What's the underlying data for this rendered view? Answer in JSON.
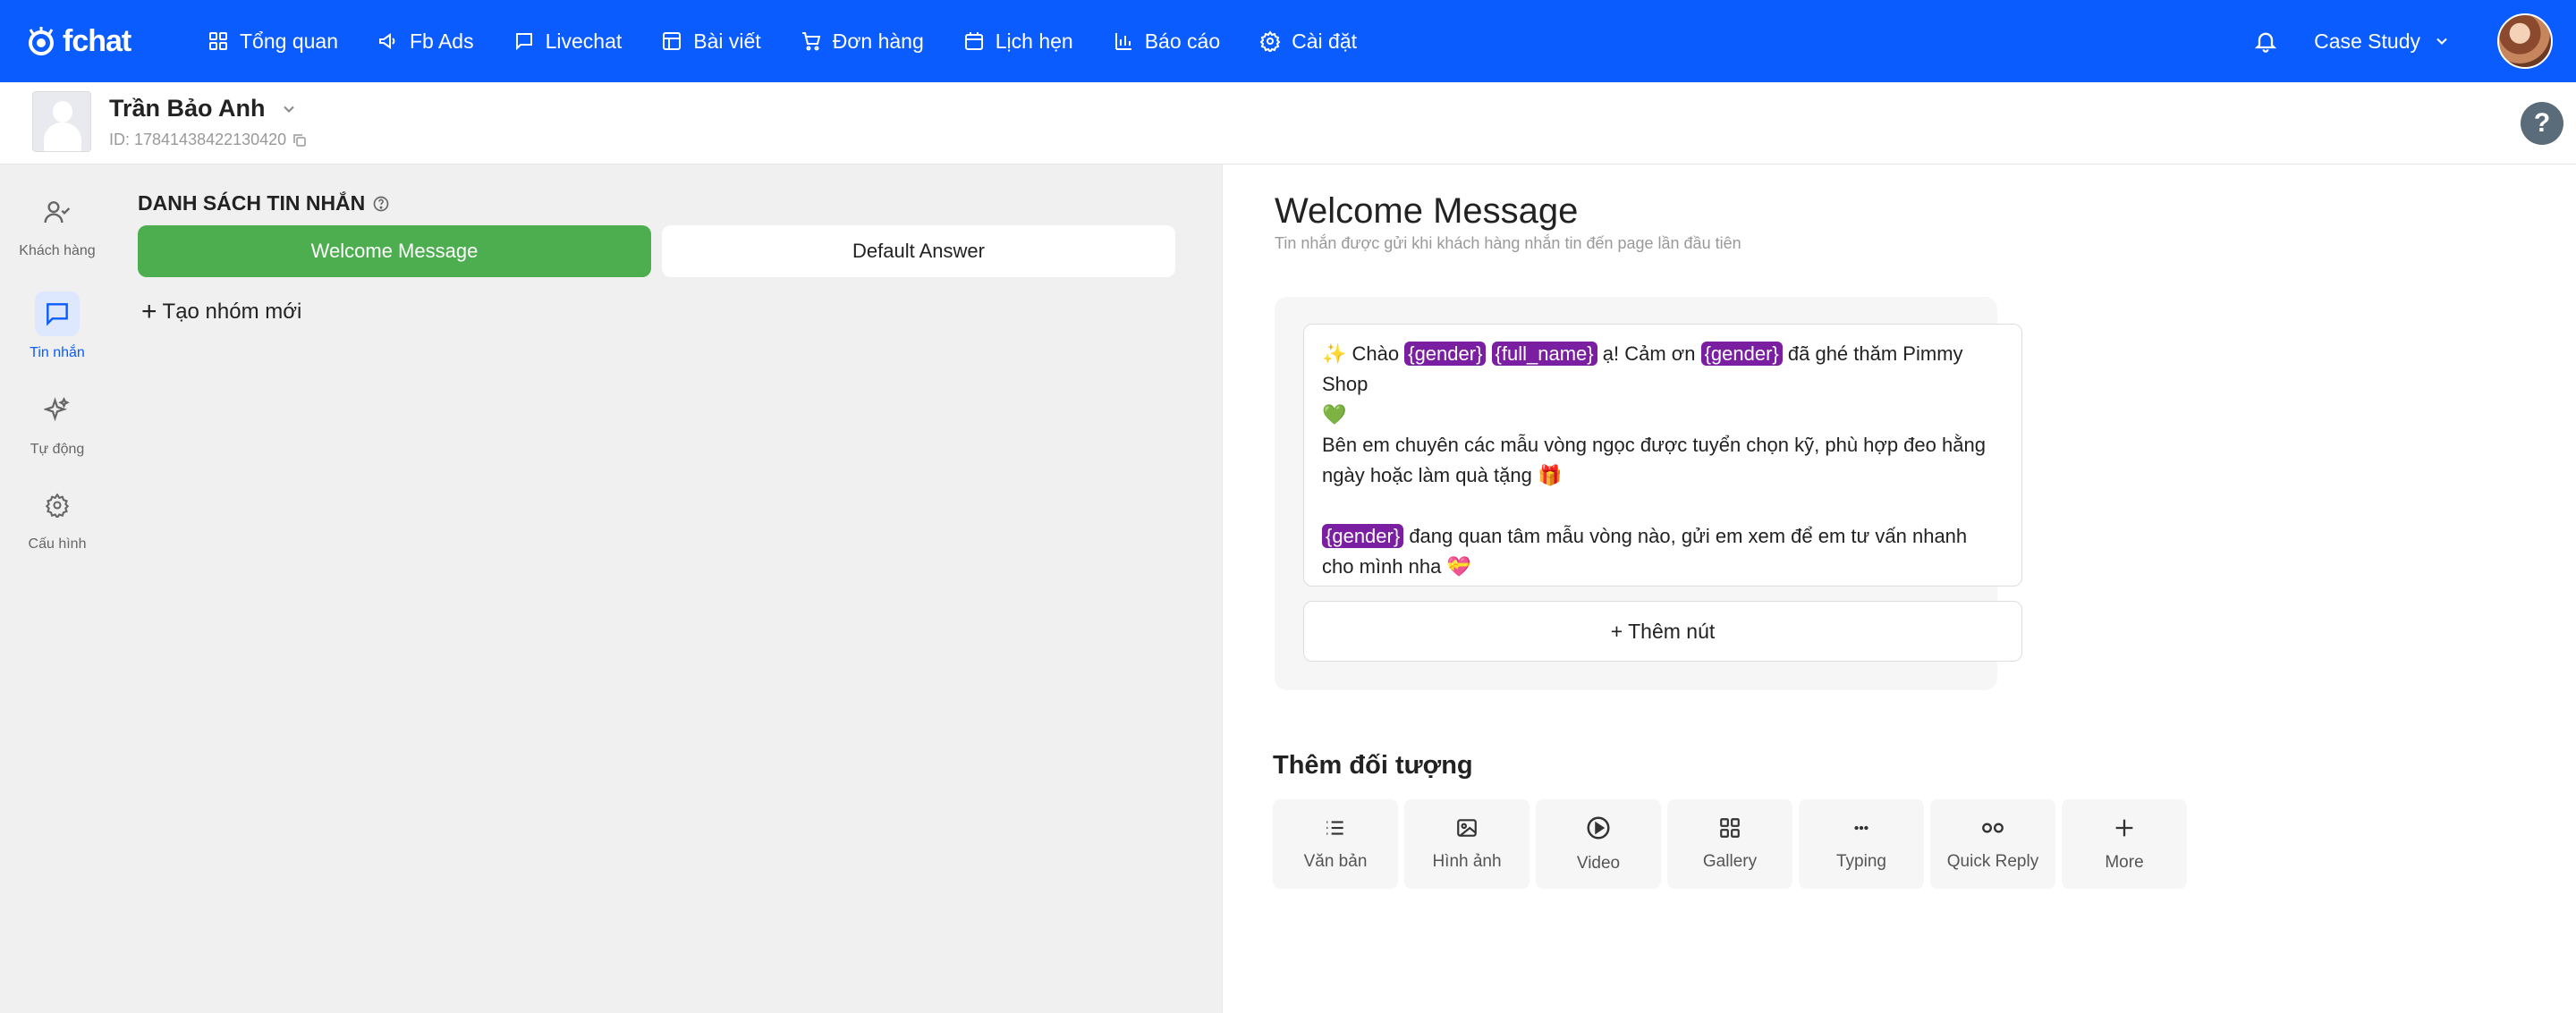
{
  "app": {
    "logo_text": "fchat"
  },
  "nav": {
    "items": [
      {
        "label": "Tổng quan",
        "icon": "dashboard-icon"
      },
      {
        "label": "Fb Ads",
        "icon": "megaphone-icon"
      },
      {
        "label": "Livechat",
        "icon": "chat-icon"
      },
      {
        "label": "Bài viết",
        "icon": "layout-icon"
      },
      {
        "label": "Đơn hàng",
        "icon": "cart-icon"
      },
      {
        "label": "Lịch hẹn",
        "icon": "calendar-icon"
      },
      {
        "label": "Báo cáo",
        "icon": "bar-chart-icon"
      },
      {
        "label": "Cài đặt",
        "icon": "gear-icon"
      }
    ],
    "account_label": "Case Study"
  },
  "profile": {
    "name": "Trần Bảo Anh",
    "id_text": "ID: 17841438422130420",
    "help_label": "?"
  },
  "sidebar": {
    "items": [
      {
        "label": "Khách hàng",
        "icon": "user-check-icon"
      },
      {
        "label": "Tin nhắn",
        "icon": "message-icon",
        "active": true
      },
      {
        "label": "Tự động",
        "icon": "sparkle-icon"
      },
      {
        "label": "Cấu hình",
        "icon": "settings-icon"
      }
    ]
  },
  "message_list": {
    "title": "DANH SÁCH TIN NHẮN",
    "tabs": [
      {
        "label": "Welcome Message",
        "active": true
      },
      {
        "label": "Default Answer",
        "active": false
      }
    ],
    "new_group_label": "Tạo nhóm mới"
  },
  "editor": {
    "title": "Welcome Message",
    "subtitle": "Tin nhắn được gửi khi khách hàng nhắn tin đến page lần đầu tiên",
    "message": {
      "line1_prefix": "✨ Chào ",
      "tag_gender": "{gender}",
      "tag_full_name": "{full_name}",
      "line1_mid": " ạ! Cảm ơn ",
      "line1_suffix": " đã ghé thăm Pimmy Shop",
      "line1_emoji": "💚",
      "line2": "Bên em chuyên các mẫu vòng ngọc được tuyển chọn kỹ, phù hợp đeo hằng ngày hoặc làm quà tặng 🎁",
      "line3_suffix": " đang quan tâm mẫu vòng nào, gửi em xem để em tư vấn nhanh cho mình nha 💝"
    },
    "add_button_label": "+ Thêm nút",
    "objects_title": "Thêm đối tượng",
    "objects": [
      {
        "label": "Văn bản",
        "icon": "text-list-icon"
      },
      {
        "label": "Hình ảnh",
        "icon": "image-icon"
      },
      {
        "label": "Video",
        "icon": "play-icon"
      },
      {
        "label": "Gallery",
        "icon": "grid-icon"
      },
      {
        "label": "Typing",
        "icon": "typing-dots-icon"
      },
      {
        "label": "Quick Reply",
        "icon": "quick-reply-icon"
      },
      {
        "label": "More",
        "icon": "plus-icon"
      }
    ]
  },
  "colors": {
    "primary": "#0a5cff",
    "active_tab": "#4cae4f",
    "tag": "#7b1fa2"
  }
}
